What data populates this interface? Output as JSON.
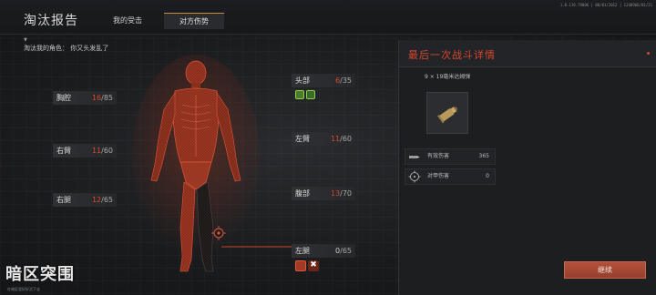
{
  "header": {
    "title": "淘汰报告",
    "tabs": [
      {
        "label": "我的受击",
        "active": false
      },
      {
        "label": "对方伤势",
        "active": true
      }
    ],
    "version": "1.0.119.79006 | 08/01/2012 | 1240966/01/21"
  },
  "killer_info": {
    "label_marker": "▼",
    "line": "淘汰我的角色：  你又头发乱了"
  },
  "body_parts": [
    {
      "name": "头部",
      "current": "6",
      "max": "/35",
      "damaged": true
    },
    {
      "name": "胸腔",
      "current": "16",
      "max": "/85",
      "damaged": true
    },
    {
      "name": "左臂",
      "current": "11",
      "max": "/60",
      "damaged": true
    },
    {
      "name": "右臂",
      "current": "11",
      "max": "/60",
      "damaged": true
    },
    {
      "name": "腹部",
      "current": "13",
      "max": "/70",
      "damaged": true
    },
    {
      "name": "右腿",
      "current": "12",
      "max": "/65",
      "damaged": true
    },
    {
      "name": "左腿",
      "current": "0",
      "max": "/65",
      "damaged": false
    }
  ],
  "status_icons": {
    "head": [
      "pain-icon",
      "tinnitus-icon"
    ],
    "left_leg": [
      "fracture-icon",
      "destroyed-icon"
    ]
  },
  "panel": {
    "title": "最后一次战斗详情",
    "weapon_name": "9 × 19毫米达姆弹",
    "stats": [
      {
        "label": "有效伤害",
        "value": "365",
        "icon": "bullet-icon"
      },
      {
        "label": "对甲伤害",
        "value": "0",
        "icon": "crosshair-icon"
      }
    ],
    "continue_label": "继续"
  },
  "logo": {
    "main": "暗区突围",
    "sub": "在暗区里好好活下去"
  },
  "colors": {
    "accent_red": "#d9472f",
    "button": "#a64733",
    "tab_underline": "#c98a4a"
  }
}
